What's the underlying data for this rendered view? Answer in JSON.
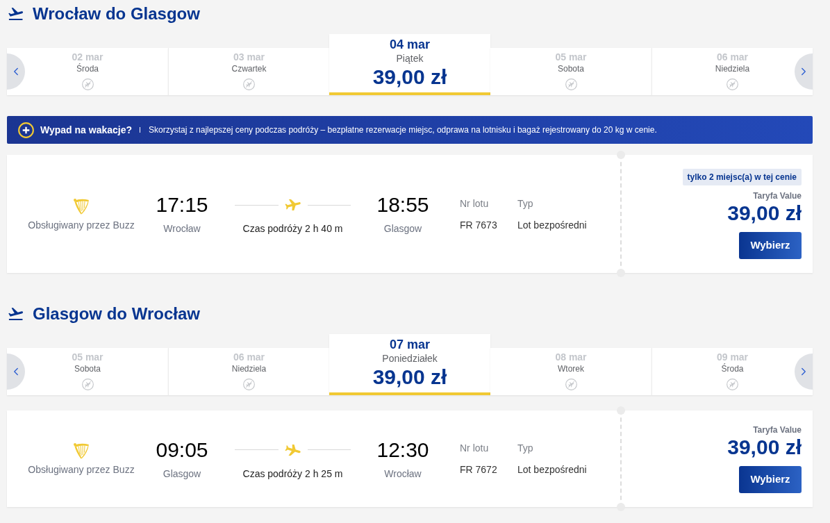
{
  "journeys": [
    {
      "title": "Wrocław do Glasgow",
      "days": [
        {
          "date": "02 mar",
          "weekday": "Środa",
          "selected": false
        },
        {
          "date": "03 mar",
          "weekday": "Czwartek",
          "selected": false
        },
        {
          "date": "04 mar",
          "weekday": "Piątek",
          "price": "39,00 zł",
          "selected": true
        },
        {
          "date": "05 mar",
          "weekday": "Sobota",
          "selected": false
        },
        {
          "date": "06 mar",
          "weekday": "Niedziela",
          "selected": false
        }
      ],
      "banner": {
        "title": "Wypad na wakacje?",
        "text": "Skorzystaj z najlepszej ceny podczas podróży – bezpłatne rezerwacje miejsc, odprawa na lotnisku i bagaż rejestrowany do 20 kg w cenie."
      },
      "flights": [
        {
          "operator": "Obsługiwany przez Buzz",
          "departure_time": "17:15",
          "departure_city": "Wrocław",
          "duration": "Czas podróży 2 h 40 m",
          "arrival_time": "18:55",
          "arrival_city": "Glasgow",
          "flight_number_label": "Nr lotu",
          "flight_number": "FR 7673",
          "type_label": "Typ",
          "type": "Lot bezpośredni",
          "seats_badge": "tylko 2 miejsc(a) w tej cenie",
          "fare": "Taryfa Value",
          "price": "39,00 zł",
          "button": "Wybierz"
        }
      ]
    },
    {
      "title": "Glasgow do Wrocław",
      "days": [
        {
          "date": "05 mar",
          "weekday": "Sobota",
          "selected": false
        },
        {
          "date": "06 mar",
          "weekday": "Niedziela",
          "selected": false
        },
        {
          "date": "07 mar",
          "weekday": "Poniedziałek",
          "price": "39,00 zł",
          "selected": true
        },
        {
          "date": "08 mar",
          "weekday": "Wtorek",
          "selected": false
        },
        {
          "date": "09 mar",
          "weekday": "Środa",
          "selected": false
        }
      ],
      "flights": [
        {
          "operator": "Obsługiwany przez Buzz",
          "departure_time": "09:05",
          "departure_city": "Glasgow",
          "duration": "Czas podróży 2 h 25 m",
          "arrival_time": "12:30",
          "arrival_city": "Wrocław",
          "flight_number_label": "Nr lotu",
          "flight_number": "FR 7672",
          "type_label": "Typ",
          "type": "Lot bezpośredni",
          "fare": "Taryfa Value",
          "price": "39,00 zł",
          "button": "Wybierz"
        }
      ]
    }
  ]
}
